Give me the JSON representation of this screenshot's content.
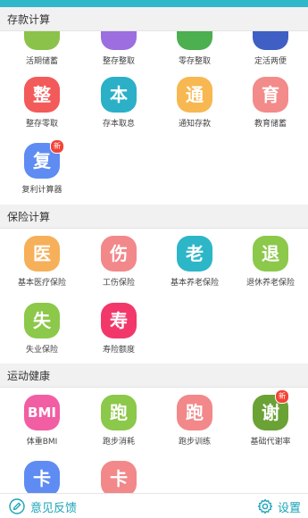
{
  "sections": {
    "deposit": {
      "title": "存款计算"
    },
    "insurance": {
      "title": "保险计算"
    },
    "sports": {
      "title": "运动健康"
    }
  },
  "deposit_row1": [
    {
      "label": "活期储蓄",
      "color": "#8bc34a"
    },
    {
      "label": "整存整取",
      "color": "#9c6ee0"
    },
    {
      "label": "零存整取",
      "color": "#4caf50"
    },
    {
      "label": "定活两便",
      "color": "#3f5fc4"
    }
  ],
  "deposit_row2": [
    {
      "icon_char": "整",
      "label": "整存零取",
      "color": "#f35a5a"
    },
    {
      "icon_char": "本",
      "label": "存本取息",
      "color": "#2bb0c8"
    },
    {
      "icon_char": "通",
      "label": "通知存款",
      "color": "#f7b851"
    },
    {
      "icon_char": "育",
      "label": "教育储蓄",
      "color": "#f28b89"
    }
  ],
  "deposit_row3": [
    {
      "icon_char": "复",
      "label": "复利计算器",
      "color": "#5f8cf3",
      "badge": "新"
    }
  ],
  "insurance_row1": [
    {
      "icon_char": "医",
      "label": "基本医疗保险",
      "color": "#f6b05a"
    },
    {
      "icon_char": "伤",
      "label": "工伤保险",
      "color": "#f2888a"
    },
    {
      "icon_char": "老",
      "label": "基本养老保险",
      "color": "#2db6c8"
    },
    {
      "icon_char": "退",
      "label": "退休养老保险",
      "color": "#8cc84a"
    }
  ],
  "insurance_row2": [
    {
      "icon_char": "失",
      "label": "失业保险",
      "color": "#8cc84a"
    },
    {
      "icon_char": "寿",
      "label": "寿险额度",
      "color": "#f2386b"
    }
  ],
  "sports_row1": [
    {
      "icon_char": "BMI",
      "label": "体重BMI",
      "color": "#f15ea3"
    },
    {
      "icon_char": "跑",
      "label": "跑步消耗",
      "color": "#8cc84a"
    },
    {
      "icon_char": "跑",
      "label": "跑步训练",
      "color": "#f2888a"
    },
    {
      "icon_char": "谢",
      "label": "基础代谢率",
      "color": "#6aa235",
      "badge": "新"
    }
  ],
  "sports_row2": [
    {
      "icon_char": "卡",
      "color": "#5f8cf3"
    },
    {
      "icon_char": "卡",
      "color": "#f2888a"
    }
  ],
  "bottom": {
    "feedback_label": "意见反馈",
    "settings_label": "设置",
    "feedback_icon": "pencil-icon",
    "settings_icon": "gear-icon",
    "accent": "#1aa3b8"
  }
}
